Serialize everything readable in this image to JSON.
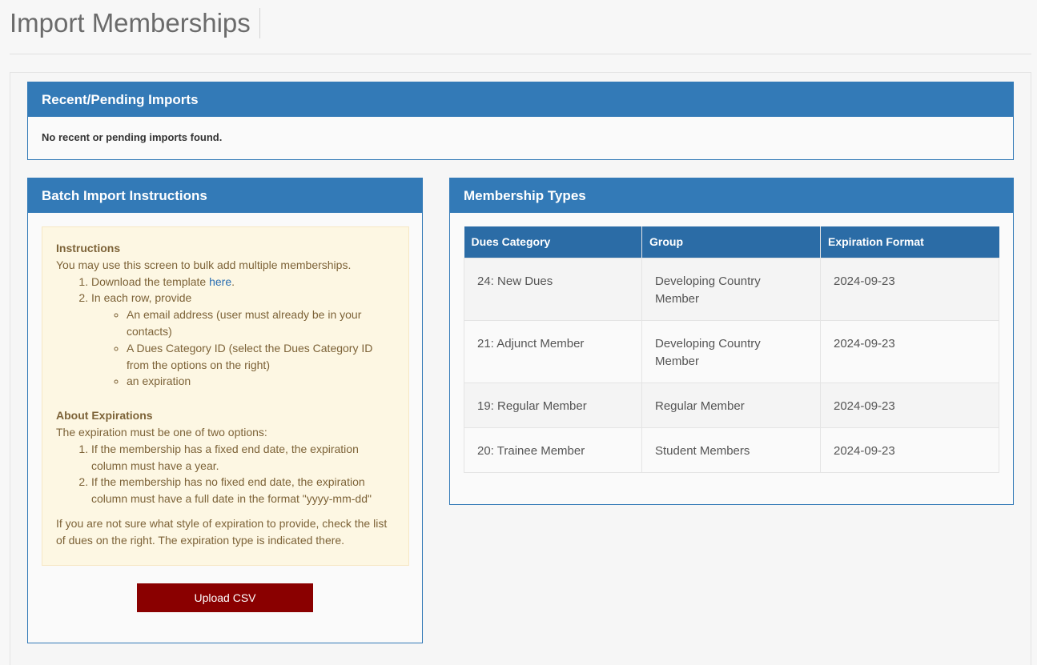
{
  "page": {
    "title": "Import Memberships"
  },
  "recent": {
    "heading": "Recent/Pending Imports",
    "empty_message": "No recent or pending imports found."
  },
  "batch": {
    "heading": "Batch Import Instructions",
    "instructions": {
      "title": "Instructions",
      "intro": "You may use this screen to bulk add multiple memberships.",
      "step1_prefix": "Download the template ",
      "step1_link": "here",
      "step1_suffix": ".",
      "step2": "In each row, provide",
      "bullets": [
        "An email address (user must already be in your contacts)",
        "A Dues Category ID (select the Dues Category ID from the options on the right)",
        "an expiration"
      ]
    },
    "expirations": {
      "title": "About Expirations",
      "intro": "The expiration must be one of two options:",
      "options": [
        "If the membership has a fixed end date, the expiration column must have a year.",
        "If the membership has no fixed end date, the expiration column must have a full date in the format \"yyyy-mm-dd\""
      ],
      "note": "If you are not sure what style of expiration to provide, check the list of dues on the right. The expiration type is indicated there."
    },
    "upload_label": "Upload CSV"
  },
  "types": {
    "heading": "Membership Types",
    "columns": [
      "Dues Category",
      "Group",
      "Expiration Format"
    ],
    "rows": [
      {
        "dues": "24: New Dues",
        "group": "Developing Country Member",
        "expiration": "2024-09-23"
      },
      {
        "dues": "21: Adjunct Member",
        "group": "Developing Country Member",
        "expiration": "2024-09-23"
      },
      {
        "dues": "19: Regular Member",
        "group": "Regular Member",
        "expiration": "2024-09-23"
      },
      {
        "dues": "20: Trainee Member",
        "group": "Student Members",
        "expiration": "2024-09-23"
      }
    ]
  }
}
